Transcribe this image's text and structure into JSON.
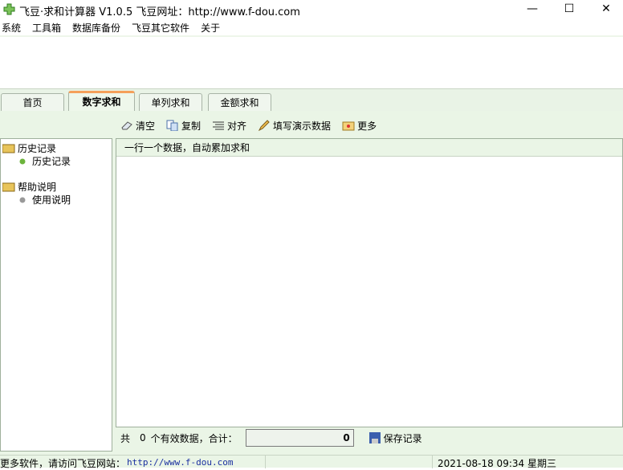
{
  "window": {
    "title": "飞豆·求和计算器 V1.0.5  飞豆网址：http://www.f-dou.com",
    "minimize": "—",
    "maximize": "☐",
    "close": "✕"
  },
  "menu": [
    "系统",
    "工具箱",
    "数据库备份",
    "飞豆其它软件",
    "关于"
  ],
  "tabs": [
    "首页",
    "数字求和",
    "单列求和",
    "金额求和"
  ],
  "toolbar": {
    "clear": "清空",
    "copy": "复制",
    "align": "对齐",
    "fill_demo": "填写演示数据",
    "more": "更多"
  },
  "tree": {
    "history_folder": "历史记录",
    "history_item": "历史记录",
    "help_folder": "帮助说明",
    "help_item": "使用说明"
  },
  "panel": {
    "header": "一行一个数据，自动累加求和",
    "input_value": ""
  },
  "bottom": {
    "prefix": "共",
    "count": "0",
    "suffix": "个有效数据，合计：",
    "total": "0",
    "save": "保存记录"
  },
  "status": {
    "text": "更多软件，请访问飞豆网站：",
    "url": "http://www.f-dou.com",
    "datetime": "2021-08-18 09:34 星期三"
  }
}
